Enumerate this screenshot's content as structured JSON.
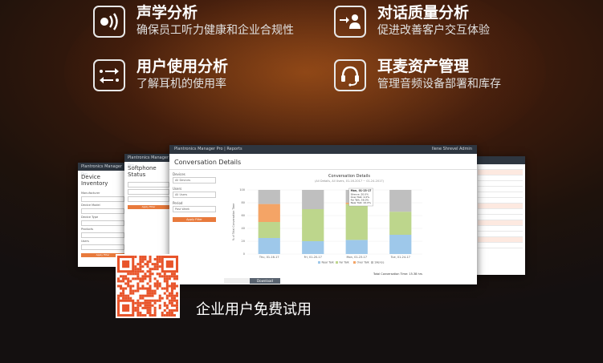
{
  "features": [
    {
      "title": "声学分析",
      "subtitle": "确保员工听力健康和企业合规性",
      "icon": "sound-wave-icon"
    },
    {
      "title": "对话质量分析",
      "subtitle": "促进改善客户交互体验",
      "icon": "user-arrows-icon"
    },
    {
      "title": "用户使用分析",
      "subtitle": "了解耳机的使用率",
      "icon": "swap-arrows-icon"
    },
    {
      "title": "耳麦资产管理",
      "subtitle": "管理音频设备部署和库存",
      "icon": "headset-icon"
    }
  ],
  "trial_text": "企业用户免费试用",
  "screens": {
    "left": {
      "app": "Plantronics Manager Pro",
      "title": "Device Inventory",
      "fields": [
        "Manufacturer",
        "Device Model",
        "Device Type",
        "Products",
        "Users"
      ],
      "button": "Apply Filter"
    },
    "middle": {
      "app": "Plantronics Manager Pro",
      "title": "Softphone Status",
      "button": "Apply Filter"
    },
    "main": {
      "app": "Plantronics Manager Pro",
      "crumb": "Reports",
      "title": "Conversation Details",
      "user": "Ilene Shrevel Admin",
      "filters": [
        {
          "label": "Devices",
          "value": "All Devices"
        },
        {
          "label": "Users",
          "value": "All Users"
        },
        {
          "label": "Period",
          "value": "Past Week"
        }
      ],
      "apply": "Apply Filter",
      "download": "Download",
      "chart_data": {
        "type": "bar",
        "stacked": true,
        "title": "Conversation Details",
        "subtitle": "(All Details, All Users, 01-16-2017 ~ 01-24-2017)",
        "ylabel": "% of Total Conversation Time",
        "ylim": [
          0,
          100
        ],
        "yticks": [
          0,
          20,
          40,
          60,
          80,
          100
        ],
        "categories": [
          "Thu, 01-16-17",
          "Fri, 01-20-17",
          "Mon, 01-23-17",
          "Tue, 01-24-17"
        ],
        "series": [
          {
            "name": "Near Talk",
            "color": "#9ec8ea",
            "values": [
              25,
              20,
              22,
              30
            ]
          },
          {
            "name": "Far Talk",
            "color": "#bdd68c",
            "values": [
              25,
              50,
              56,
              36
            ]
          },
          {
            "name": "Over Talk",
            "color": "#f4a466",
            "values": [
              28,
              0,
              2,
              0
            ]
          },
          {
            "name": "Silence",
            "color": "#bfbfbf",
            "values": [
              22,
              30,
              20,
              34
            ]
          }
        ],
        "tooltip": {
          "title": "Mon, 01-23-17",
          "lines": [
            "Silence: 20.0%",
            "Over Talk: 2.0%",
            "Far Talk: 56.0%",
            "Near Talk: 22.0%"
          ]
        },
        "legend": "bottom",
        "footer": "Total Conversation Time: 15.38 hrs"
      }
    }
  }
}
